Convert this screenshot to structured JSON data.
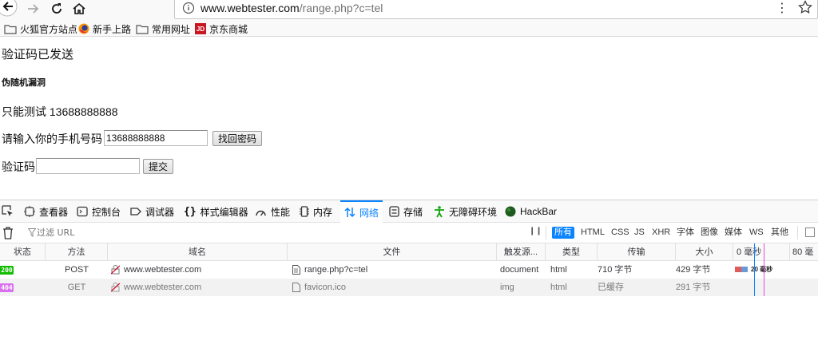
{
  "browser": {
    "url_domain": "www.webtester.com",
    "url_path": "/range.php?c=tel",
    "menu_glyph": "⋮",
    "bookmarks": [
      {
        "label": "火狐官方站点",
        "icon": "folder-icon"
      },
      {
        "label": "新手上路",
        "icon": "firefox-icon"
      },
      {
        "label": "常用网址",
        "icon": "folder-icon"
      },
      {
        "label": "京东商城",
        "icon": "jd-icon"
      }
    ],
    "jd_logo_text": "JD"
  },
  "page": {
    "sent_msg": "验证码已发送",
    "heading": "伪随机漏洞",
    "test_line": "只能测试 13688888888",
    "phone_label": "请输入你的手机号码",
    "phone_value": "13688888888",
    "find_pw_button": "找回密码",
    "code_label": "验证码",
    "code_value": "",
    "submit_button": "提交"
  },
  "devtools": {
    "tabs": [
      {
        "label": "查看器",
        "icon": "inspector-icon"
      },
      {
        "label": "控制台",
        "icon": "console-icon"
      },
      {
        "label": "调试器",
        "icon": "debugger-icon"
      },
      {
        "label": "样式编辑器",
        "icon": "style-editor-icon"
      },
      {
        "label": "性能",
        "icon": "performance-icon"
      },
      {
        "label": "内存",
        "icon": "memory-icon"
      },
      {
        "label": "网络",
        "icon": "network-icon"
      },
      {
        "label": "存储",
        "icon": "storage-icon"
      },
      {
        "label": "无障碍环境",
        "icon": "accessibility-icon"
      },
      {
        "label": "HackBar",
        "icon": "hackbar-icon"
      }
    ],
    "selected_tab": "网络",
    "filter_placeholder": "过滤 URL",
    "pause_glyph": "❙❙",
    "filters": [
      "所有",
      "HTML",
      "CSS",
      "JS",
      "XHR",
      "字体",
      "图像",
      "媒体",
      "WS",
      "其他"
    ],
    "active_filter": "所有",
    "columns": [
      "状态",
      "方法",
      "域名",
      "文件",
      "触发源...",
      "类型",
      "传输",
      "大小"
    ],
    "timeline_ticks": [
      "0 毫秒",
      "80 毫"
    ],
    "requests": [
      {
        "status": "200",
        "status_color": "#12bc00",
        "method": "POST",
        "domain": "www.webtester.com",
        "file": "range.php?c=tel",
        "cause": "document",
        "type": "html",
        "transferred": "710 字节",
        "size": "429 字节",
        "timing": "20 毫秒"
      },
      {
        "status": "404",
        "status_color": "#d970ee",
        "method": "GET",
        "domain": "www.webtester.com",
        "file": "favicon.ico",
        "cause": "img",
        "type": "html",
        "transferred": "已缓存",
        "size": "291 字节",
        "timing": ""
      }
    ]
  }
}
